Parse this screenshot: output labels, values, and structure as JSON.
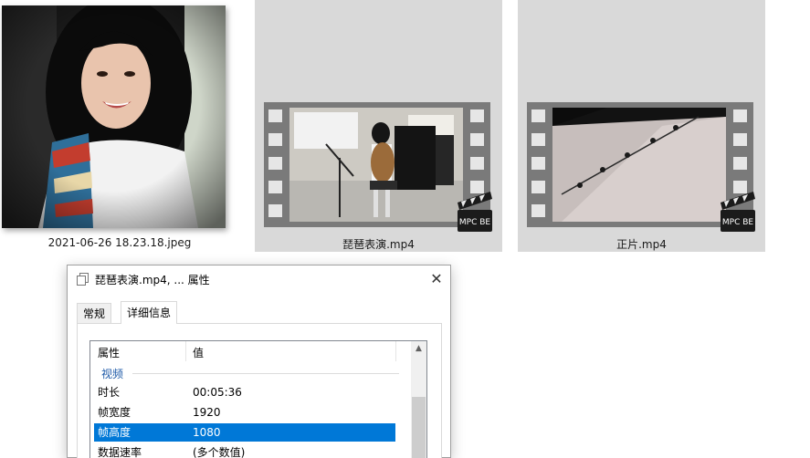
{
  "files": [
    {
      "name": "2021-06-26 18.23.18.jpeg",
      "type": "image",
      "icon": "photo-thumbnail"
    },
    {
      "name": "琵琶表演.mp4",
      "type": "video",
      "icon": "mpc-be-video-thumbnail",
      "badge": "MPC BE"
    },
    {
      "name": "正片.mp4",
      "type": "video",
      "icon": "mpc-be-video-thumbnail",
      "badge": "MPC BE"
    }
  ],
  "dialog": {
    "title": "琵琶表演.mp4, ... 属性",
    "close_glyph": "✕",
    "tabs": [
      {
        "label": "常规",
        "active": false
      },
      {
        "label": "详细信息",
        "active": true
      }
    ],
    "columns": {
      "property": "属性",
      "value": "值"
    },
    "group": "视频",
    "rows": [
      {
        "key": "时长",
        "value": "00:05:36",
        "selected": false
      },
      {
        "key": "帧宽度",
        "value": "1920",
        "selected": false
      },
      {
        "key": "帧高度",
        "value": "1080",
        "selected": true
      },
      {
        "key": "数据速率",
        "value": "(多个数值)",
        "selected": false
      }
    ]
  },
  "colors": {
    "selection": "#0078d7",
    "group_label": "#1e5aa8",
    "tile_background": "#d9d9d9",
    "filmstrip": "#7a7a7a"
  }
}
